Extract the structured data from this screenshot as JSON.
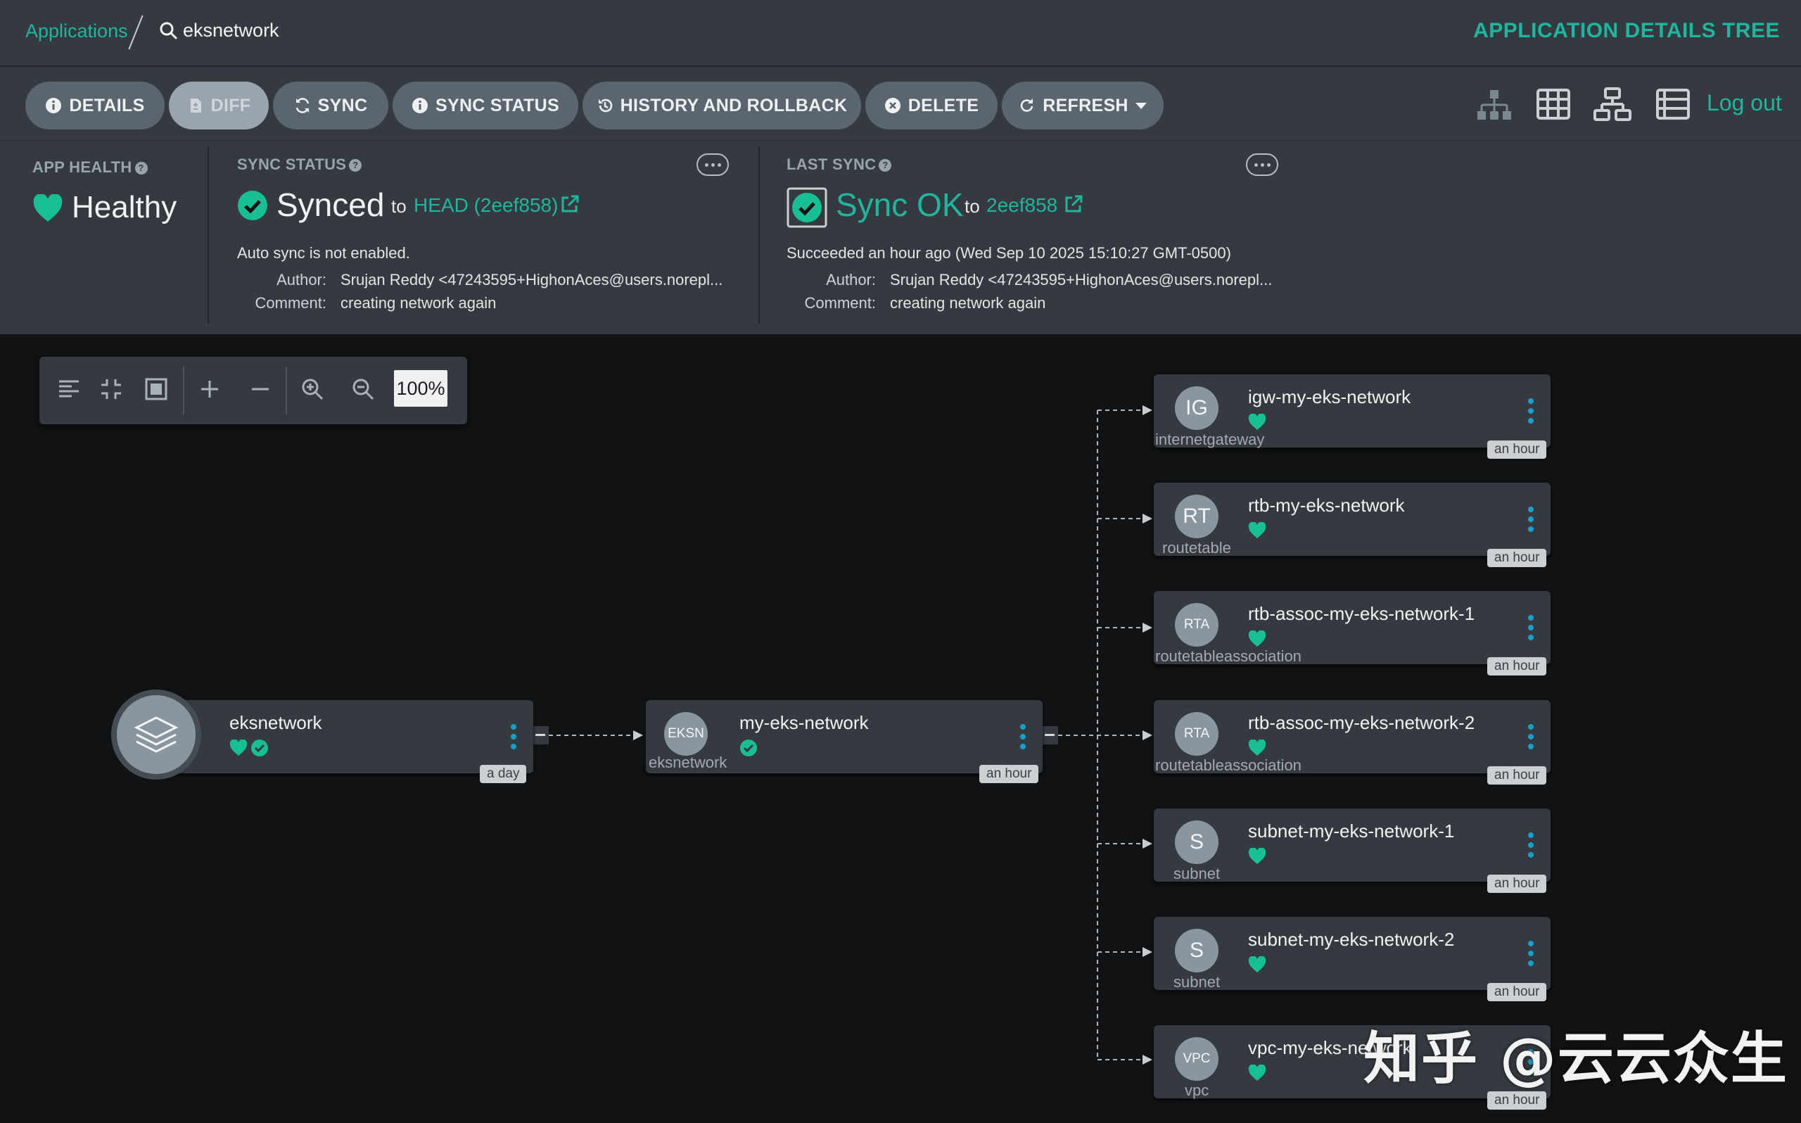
{
  "breadcrumb": {
    "applications": "Applications",
    "app_name": "eksnetwork"
  },
  "page_title": "APPLICATION DETAILS TREE",
  "toolbar": {
    "details": "DETAILS",
    "diff": "DIFF",
    "sync": "SYNC",
    "sync_status": "SYNC STATUS",
    "history": "HISTORY AND ROLLBACK",
    "delete": "DELETE",
    "refresh": "REFRESH",
    "logout": "Log out"
  },
  "status": {
    "app_health_title": "APP HEALTH",
    "app_health_value": "Healthy",
    "sync_status_title": "SYNC STATUS",
    "sync_status_value": "Synced",
    "sync_to": "to",
    "sync_revision": "HEAD (2eef858)",
    "auto_sync_note": "Auto sync is not enabled.",
    "author_label": "Author:",
    "author": "Srujan Reddy <47243595+HighonAces@users.norepl...",
    "comment_label": "Comment:",
    "comment": "creating network again",
    "last_sync_title": "LAST SYNC",
    "last_sync_value": "Sync OK",
    "last_sync_to": "to",
    "last_sync_revision": "2eef858",
    "last_sync_when": "Succeeded an hour ago (Wed Sep 10 2025 15:10:27 GMT-0500)",
    "last_author": "Srujan Reddy <47243595+HighonAces@users.norepl...",
    "last_comment": "creating network again"
  },
  "zoom": {
    "level": "100%"
  },
  "graph": {
    "app_node": {
      "name": "eksnetwork",
      "age": "a day"
    },
    "eks_node": {
      "icon": "EKSN",
      "name": "my-eks-network",
      "kind": "eksnetwork",
      "age": "an hour"
    },
    "children": [
      {
        "icon": "IG",
        "name": "igw-my-eks-network",
        "kind": "internetgateway",
        "age": "an hour"
      },
      {
        "icon": "RT",
        "name": "rtb-my-eks-network",
        "kind": "routetable",
        "age": "an hour"
      },
      {
        "icon": "RTA",
        "name": "rtb-assoc-my-eks-network-1",
        "kind": "routetableassociation",
        "age": "an hour"
      },
      {
        "icon": "RTA",
        "name": "rtb-assoc-my-eks-network-2",
        "kind": "routetableassociation",
        "age": "an hour"
      },
      {
        "icon": "S",
        "name": "subnet-my-eks-network-1",
        "kind": "subnet",
        "age": "an hour"
      },
      {
        "icon": "S",
        "name": "subnet-my-eks-network-2",
        "kind": "subnet",
        "age": "an hour"
      },
      {
        "icon": "VPC",
        "name": "vpc-my-eks-network",
        "kind": "vpc",
        "age": "an hour"
      }
    ]
  },
  "watermark": "知乎 @云云众生",
  "colors": {
    "accent": "#1fb59e",
    "healthy": "#18be94",
    "panel": "#343a40",
    "background": "#111214"
  }
}
